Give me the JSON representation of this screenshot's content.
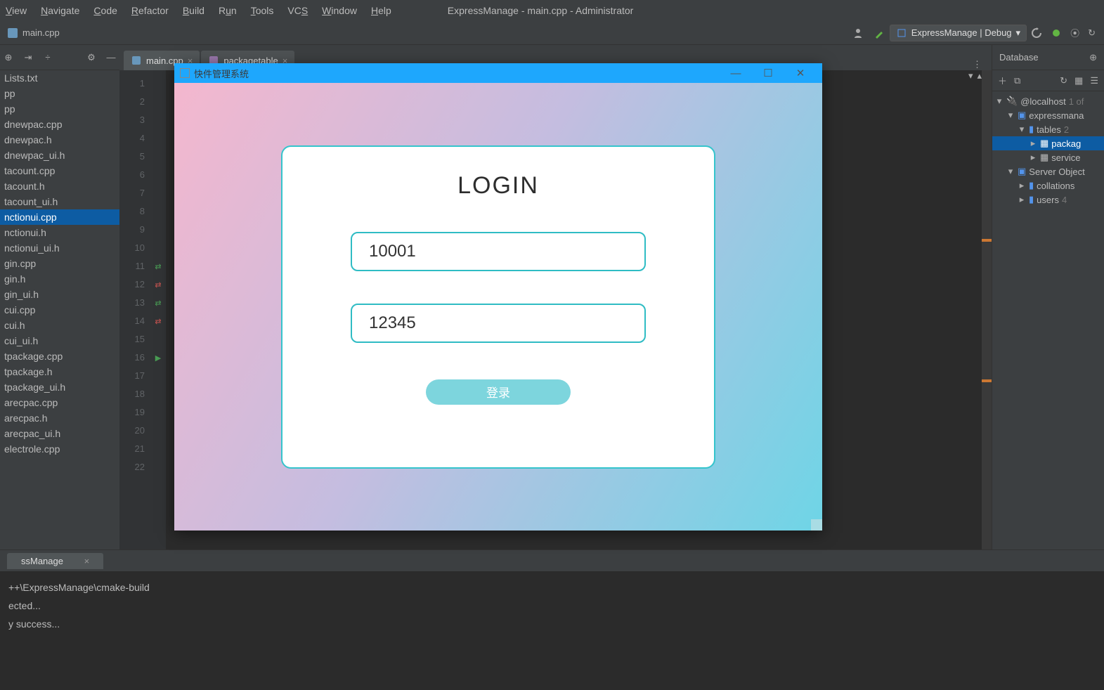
{
  "menu": {
    "view": "View",
    "nav": "Navigate",
    "code": "Code",
    "refactor": "Refactor",
    "build": "Build",
    "run": "Run",
    "tools": "Tools",
    "vcs": "VCS",
    "window": "Window",
    "help": "Help"
  },
  "title_path": "ExpressManage - main.cpp - Administrator",
  "toptab": {
    "file": "main.cpp"
  },
  "run_config": "ExpressManage | Debug",
  "editor_tabs": {
    "t1": "main.cpp",
    "t2": "packagetable"
  },
  "files": [
    "Lists.txt",
    "pp",
    "pp",
    "dnewpac.cpp",
    "dnewpac.h",
    "dnewpac_ui.h",
    "tacount.cpp",
    "tacount.h",
    "tacount_ui.h",
    "nctionui.cpp",
    "nctionui.h",
    "nctionui_ui.h",
    "gin.cpp",
    "gin.h",
    "gin_ui.h",
    "cui.cpp",
    "cui.h",
    "cui_ui.h",
    "tpackage.cpp",
    "tpackage.h",
    "tpackage_ui.h",
    "arecpac.cpp",
    "arecpac.h",
    "arecpac_ui.h",
    "electrole.cpp"
  ],
  "selected_file_index": 9,
  "lines": [
    "1",
    "2",
    "3",
    "4",
    "5",
    "6",
    "7",
    "8",
    "9",
    "10",
    "11",
    "12",
    "13",
    "14",
    "15",
    "16",
    "17",
    "18",
    "19",
    "20",
    "21",
    "22"
  ],
  "gutter_marks": {
    "11": "⇄",
    "12": "⇄",
    "13": "⇄",
    "14": "⇄",
    "16": "▶"
  },
  "db": {
    "panel_title": "Database",
    "root": "@localhost",
    "root_hint": "1 of",
    "schema": "expressmana",
    "tables_label": "tables",
    "tables_count": "2",
    "t1": "packag",
    "t2": "service",
    "srv": "Server Object",
    "n1": "collations",
    "n2": "users",
    "n2_count": "4"
  },
  "bottom_tab": "ssManage",
  "console": [
    "++\\ExpressManage\\cmake-build",
    "ected...",
    "y success..."
  ],
  "dialog": {
    "title": "快件管理系统",
    "login_label": "LOGIN",
    "username": "10001",
    "password": "12345",
    "button": "登录"
  }
}
